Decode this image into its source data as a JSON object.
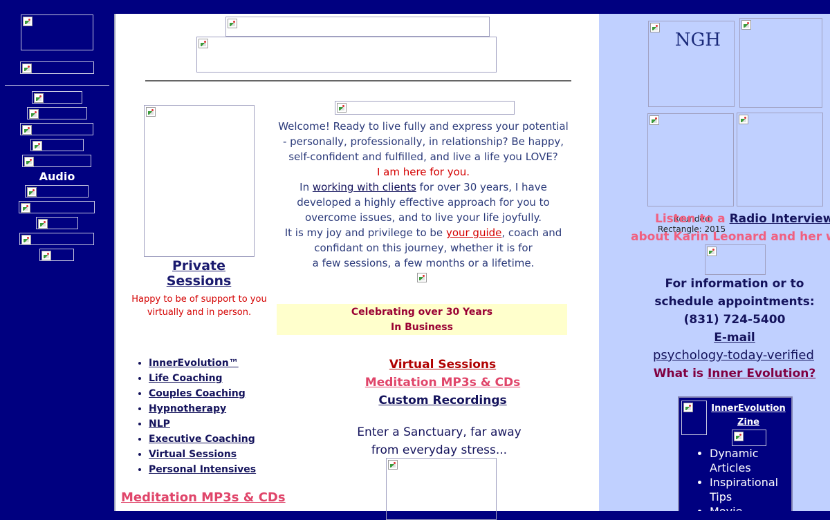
{
  "left_nav": {
    "audio_label": "Audio"
  },
  "main": {
    "welcome": {
      "line1": "Welcome!  Ready to live fully and express your potential - personally, professionally, in relationship? Be happy, self-confident and fulfilled, and live a life you LOVE?",
      "here_for_you": "I am here for you.",
      "in_prefix": "In",
      "working_link": "working with clients",
      "in_suffix": "for over 30 years, I have developed a highly effective approach for you to overcome issues, and to live your life joyfully.",
      "joy_prefix": "It is my joy and privilege to be",
      "guide_link": "your guide",
      "joy_suffix": ", coach and confidant on this journey, whether it is for",
      "few_sessions": "a few sessions, a few months or a lifetime."
    },
    "private_sessions": "Private Sessions",
    "happy_text": "Happy to be of support to you virtually and in person.",
    "celebrate_line1": "Celebrating over 30 Years",
    "celebrate_line2": "In Business",
    "services": [
      "InnerEvolution™",
      "Life Coaching",
      "Couples Coaching",
      "Hypnotherapy",
      "NLP",
      "Executive Coaching",
      "Virtual Sessions",
      "Personal Intensives"
    ],
    "meditation_left": "Meditation MP3s & CDs",
    "center_links": {
      "virtual": "Virtual Sessions",
      "meditation": "Meditation MP3s & CDs",
      "custom": "Custom Recordings"
    },
    "sanctuary_line1": "Enter a Sanctuary, far away",
    "sanctuary_line2": "from everyday stress..."
  },
  "right": {
    "ngh_alt": "NGH",
    "rounded_rect_alt": "Rounded Rectangle: 2015",
    "listen_prefix": "Listen to a",
    "radio_link": "Radio Interview",
    "listen_line2": "about Karin Leonard and her work",
    "info_line1": "For information or to",
    "info_line2": "schedule appointments:",
    "phone": "(831) 724-5400",
    "email": "E-mail",
    "psych_alt": "psychology-today-verified",
    "what_prefix": "What is",
    "what_link": "Inner Evolution?",
    "zine": {
      "title": "InnerEvolution Zine",
      "items": [
        "Dynamic Articles",
        "Inspirational Tips",
        "Movie Reviews"
      ]
    }
  },
  "colors": {
    "nav_bg": "#000080",
    "right_bg": "#c0d0ff",
    "accent_red": "#d40000",
    "accent_pink": "#e0456a",
    "navy_text": "#14135c"
  }
}
